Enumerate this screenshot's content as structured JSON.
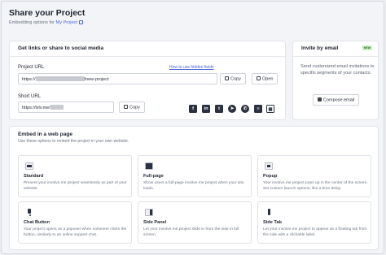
{
  "header": {
    "title": "Share your Project",
    "subtitle_prefix": "Embedding options for",
    "subtitle_link": "My Project"
  },
  "share": {
    "heading": "Get links or share to social media",
    "project_url_label": "Project URL",
    "hidden_fields_link": "How to use hidden fields",
    "project_url_prefix": "https://",
    "project_url_suffix": "/new-project",
    "copy_label": "Copy",
    "open_label": "Open",
    "short_url_label": "Short URL",
    "short_url_prefix": "https://lvlv.me/",
    "short_copy_label": "Copy",
    "social_icons": [
      "facebook-icon",
      "linkedin-icon",
      "twitter-icon",
      "telegram-icon",
      "whatsapp-icon",
      "buffer-icon",
      "qr-code-icon"
    ]
  },
  "invite": {
    "heading": "Invite by email",
    "badge": "NEW",
    "description": "Send customized email invitations to specific segments of your contacts.",
    "button_label": "Compose email"
  },
  "embed": {
    "heading": "Embed in a web page",
    "description": "Use these options to embed the project in your own website.",
    "options": [
      {
        "name": "Standard",
        "desc": "Present your involve.me project seamlessly as part of your website."
      },
      {
        "name": "Full-page",
        "desc": "Show users a full-page involve.me project when your site loads."
      },
      {
        "name": "Popup",
        "desc": "Your involve.me project pops up in the center of the screen. Set custom launch options, like a time delay."
      },
      {
        "name": "Chat Button",
        "desc": "Your project opens as a popover when someone clicks the button, similarly to an online support chat."
      },
      {
        "name": "Side Panel",
        "desc": "Let your involve.me project slide in from the side in full screen."
      },
      {
        "name": "Side Tab",
        "desc": "Let your involve.me project to appear as a floating tab from the side with a clickable label."
      }
    ]
  }
}
